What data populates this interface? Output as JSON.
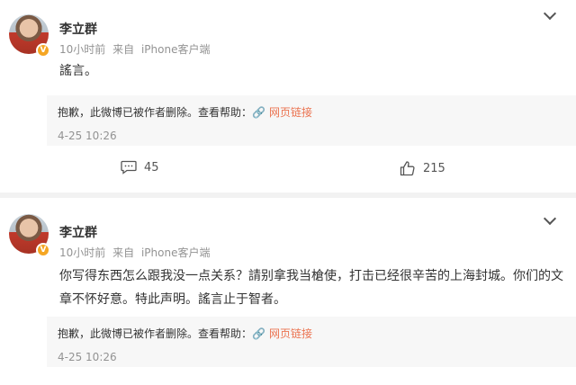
{
  "posts": [
    {
      "author": "李立群",
      "time_ago": "10小时前",
      "source_prefix": "来自",
      "source": "iPhone客户端",
      "text": "謠言。",
      "deleted_notice": "抱歉，此微博已被作者删除。查看帮助：",
      "help_link": "网页链接",
      "timestamp": "4-25 10:26",
      "comments": "45",
      "likes": "215",
      "verified_badge": "V"
    },
    {
      "author": "李立群",
      "time_ago": "10小时前",
      "source_prefix": "来自",
      "source": "iPhone客户端",
      "text": "你写得东西怎么跟我没一点关系？請别拿我当槍使，打击已经很辛苦的上海封城。你们的文章不怀好意。特此声明。謠言止于智者。",
      "deleted_notice": "抱歉，此微博已被作者删除。查看帮助：",
      "help_link": "网页链接",
      "timestamp": "4-25 10:26",
      "verified_badge": "V"
    }
  ],
  "colors": {
    "link": "#eb7350",
    "meta": "#939393",
    "badge": "#f5a623"
  },
  "icons": [
    "chevron-down-icon",
    "link-icon",
    "comment-icon",
    "like-icon",
    "verified-badge-icon"
  ]
}
